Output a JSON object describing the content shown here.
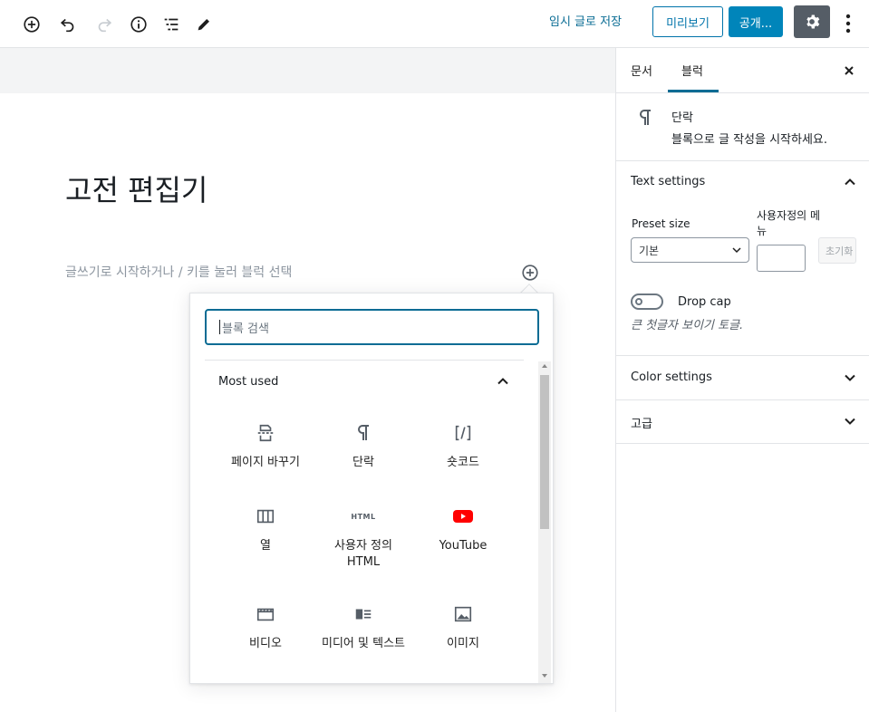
{
  "toolbar": {
    "save_draft": "임시 글로 저장",
    "preview": "미리보기",
    "publish": "공개..."
  },
  "editor": {
    "title": "고전 편집기",
    "placeholder": "글쓰기로 시작하거나 / 키를 눌러 블럭 선택"
  },
  "inserter": {
    "search_placeholder": "블록 검색",
    "section_title": "Most used",
    "blocks": [
      {
        "label": "페이지 바꾸기",
        "icon": "page-break-icon"
      },
      {
        "label": "단락",
        "icon": "paragraph-icon"
      },
      {
        "label": "숏코드",
        "icon": "shortcode-icon"
      },
      {
        "label": "열",
        "icon": "columns-icon"
      },
      {
        "label": "사용자 정의 HTML",
        "icon": "html-icon"
      },
      {
        "label": "YouTube",
        "icon": "youtube-icon"
      },
      {
        "label": "비디오",
        "icon": "video-icon"
      },
      {
        "label": "미디어 및 텍스트",
        "icon": "media-text-icon"
      },
      {
        "label": "이미지",
        "icon": "image-icon"
      }
    ],
    "html_icon_text": "HTML"
  },
  "sidebar": {
    "tabs": [
      "문서",
      "블럭"
    ],
    "active_tab": "블럭",
    "block_card": {
      "title": "단락",
      "description": "블록으로 글 작성을 시작하세요."
    },
    "text_settings": {
      "title": "Text settings",
      "preset_label": "Preset size",
      "custom_label": "사용자정의 메뉴",
      "preset_value": "기본",
      "reset_label": "초기화",
      "dropcap_label": "Drop cap",
      "dropcap_help": "큰 첫글자 보이기 토글."
    },
    "panels": [
      "Color settings",
      "고급"
    ]
  },
  "colors": {
    "accent": "#0085ba",
    "link": "#0a6c94",
    "youtube_red": "#ff0000"
  }
}
